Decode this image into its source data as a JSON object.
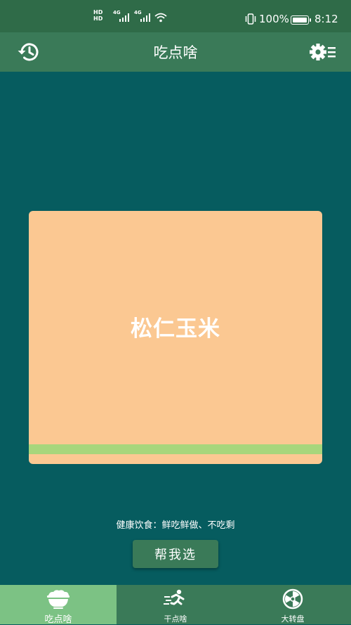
{
  "status_bar": {
    "hd_1": "HD",
    "hd_2": "HD",
    "net_1": "4G",
    "net_2": "4G",
    "battery_text": "100%",
    "time": "8:12"
  },
  "app_bar": {
    "title": "吃点啥",
    "history_icon": "history-icon",
    "settings_icon": "settings-icon"
  },
  "card": {
    "food_name": "松仁玉米",
    "background_color": "#fbc892",
    "band_color": "#a7d67c"
  },
  "tip": "健康饮食：鲜吃鲜做、不吃剩",
  "pick_button_label": "帮我选",
  "bottom_nav": {
    "items": [
      {
        "label": "吃点啥",
        "icon": "rice-bowl-icon",
        "active": true
      },
      {
        "label": "干点啥",
        "icon": "running-icon",
        "active": false
      },
      {
        "label": "大转盘",
        "icon": "wheel-icon",
        "active": false
      }
    ]
  },
  "colors": {
    "background": "#065c5f",
    "bar": "#3a7a58",
    "active_tab": "#7cc284"
  }
}
